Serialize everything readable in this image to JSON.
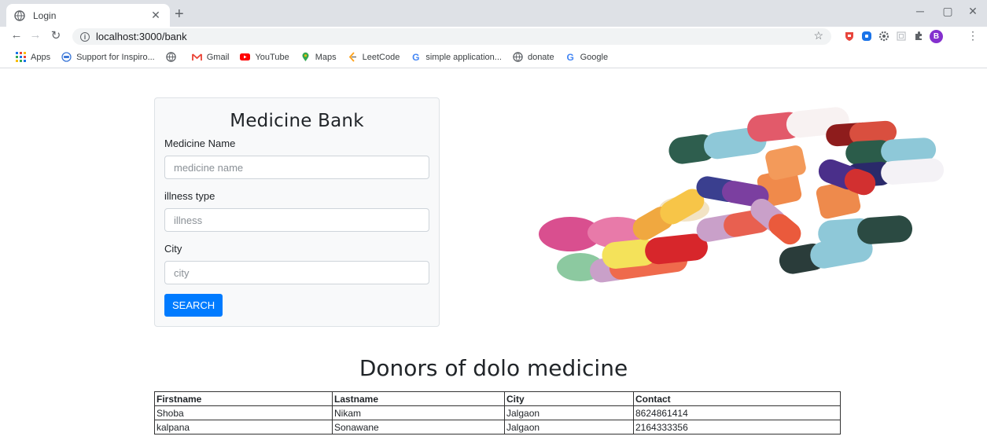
{
  "browser": {
    "tab_title": "Login",
    "url": "localhost:3000/bank",
    "profile_initial": "B",
    "bookmarks": [
      {
        "label": "Apps",
        "icon": "apps-grid-icon"
      },
      {
        "label": "Support for Inspiro...",
        "icon": "inspiro-icon"
      },
      {
        "label": "",
        "icon": "globe-icon"
      },
      {
        "label": "Gmail",
        "icon": "gmail-icon"
      },
      {
        "label": "YouTube",
        "icon": "youtube-icon"
      },
      {
        "label": "Maps",
        "icon": "maps-icon"
      },
      {
        "label": "LeetCode",
        "icon": "leetcode-icon"
      },
      {
        "label": "simple application...",
        "icon": "google-icon"
      },
      {
        "label": "donate",
        "icon": "globe-icon"
      },
      {
        "label": "Google",
        "icon": "google-icon"
      }
    ]
  },
  "form": {
    "title": "Medicine Bank",
    "medicine_label": "Medicine Name",
    "medicine_placeholder": "medicine name",
    "illness_label": "illness type",
    "illness_placeholder": "illness",
    "city_label": "City",
    "city_placeholder": "city",
    "search_label": "SEARCH",
    "button_color": "#007bff"
  },
  "donors": {
    "title": "Donors of dolo medicine",
    "headers": [
      "Firstname",
      "Lastname",
      "City",
      "Contact"
    ],
    "rows": [
      [
        "Shoba",
        "Nikam",
        "Jalgaon",
        "8624861414"
      ],
      [
        "kalpana",
        "Sonawane",
        "Jalgaon",
        "2164333356"
      ]
    ]
  }
}
